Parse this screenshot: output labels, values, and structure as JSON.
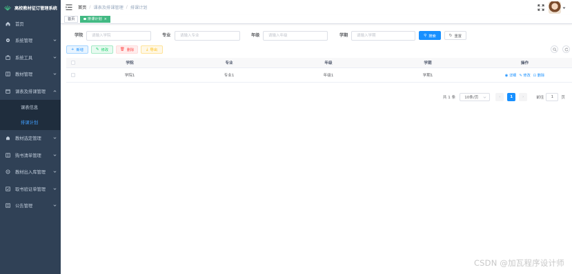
{
  "app": {
    "title": "高校教材征订管理系统",
    "logo_icon": "leaf-logo-icon"
  },
  "sidebar": {
    "items": [
      {
        "label": "首页",
        "icon": "dashboard-icon",
        "expandable": false
      },
      {
        "label": "系统管理",
        "icon": "gear-icon",
        "expandable": true
      },
      {
        "label": "系统工具",
        "icon": "tool-icon",
        "expandable": true
      },
      {
        "label": "教材管理",
        "icon": "book-icon",
        "expandable": true
      },
      {
        "label": "课表及排课管理",
        "icon": "calendar-icon",
        "expandable": true,
        "expanded": true,
        "children": [
          {
            "label": "课表信息",
            "active": false
          },
          {
            "label": "排课计划",
            "active": true
          }
        ]
      },
      {
        "label": "教材选定管理",
        "icon": "select-icon",
        "expandable": true
      },
      {
        "label": "购书清单管理",
        "icon": "list-icon",
        "expandable": true
      },
      {
        "label": "教材出入库管理",
        "icon": "storage-icon",
        "expandable": true
      },
      {
        "label": "取书验证单管理",
        "icon": "verify-icon",
        "expandable": true
      },
      {
        "label": "公告管理",
        "icon": "notice-icon",
        "expandable": true
      }
    ]
  },
  "navbar": {
    "breadcrumb": [
      "首页",
      "课表及排课管理",
      "排课计划"
    ]
  },
  "tags": [
    {
      "label": "首页",
      "active": false
    },
    {
      "label": "排课计划",
      "active": true,
      "close": "×"
    }
  ],
  "search": {
    "fields": [
      {
        "label": "学院",
        "placeholder": "请输入学院"
      },
      {
        "label": "专业",
        "placeholder": "请输入专业"
      },
      {
        "label": "年级",
        "placeholder": "请输入年级"
      },
      {
        "label": "学期",
        "placeholder": "请输入学期"
      }
    ],
    "search_label": "搜索",
    "reset_label": "重置"
  },
  "toolbar": {
    "add_label": "新增",
    "edit_label": "修改",
    "delete_label": "删除",
    "export_label": "导出"
  },
  "table": {
    "columns": [
      "学院",
      "专业",
      "年级",
      "学期",
      "操作"
    ],
    "rows": [
      {
        "college": "学院1",
        "major": "专业1",
        "grade": "年级1",
        "term": "学期1"
      }
    ],
    "row_actions": {
      "detail": "详细",
      "edit": "修改",
      "delete": "删除"
    }
  },
  "pagination": {
    "total": "共 1 条",
    "page_size": "10条/页",
    "current_page": "1",
    "goto_label": "前往",
    "goto_value": "1",
    "page_suffix": "页"
  },
  "watermark": "CSDN @加瓦程序设计师",
  "colors": {
    "sidebar_bg": "#304156",
    "primary": "#1890ff",
    "active_tag": "#42b983"
  }
}
